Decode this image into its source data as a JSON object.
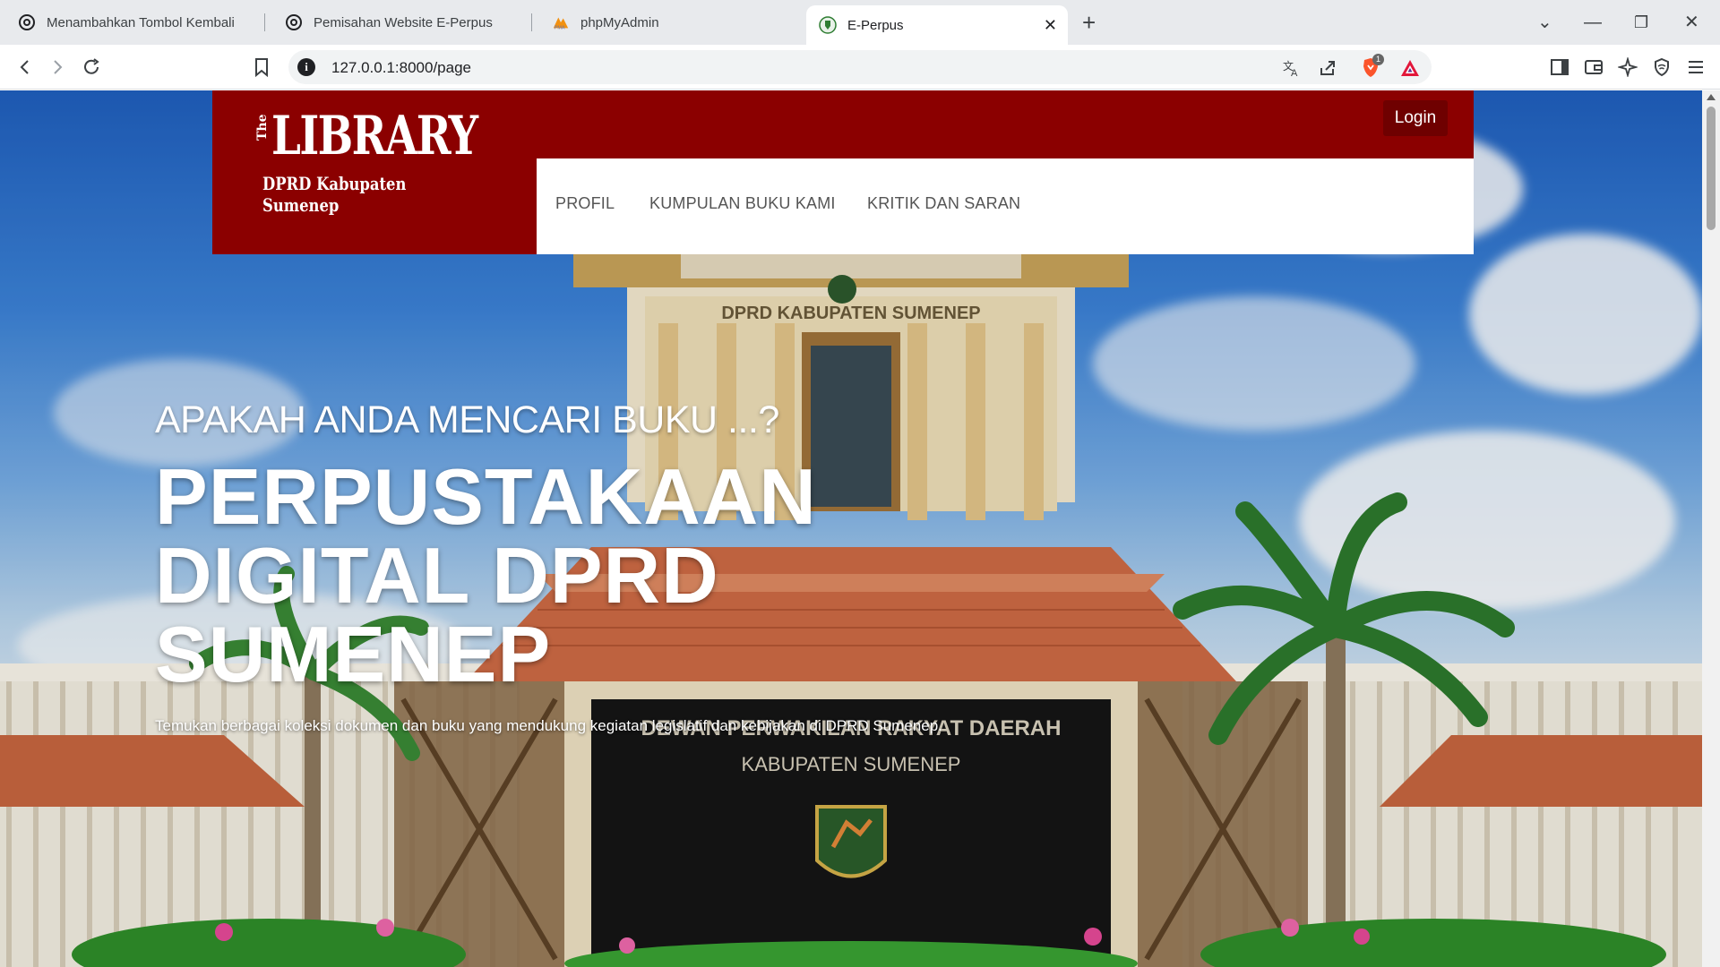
{
  "browser": {
    "tabs": [
      {
        "title": "Menambahkan Tombol Kembali",
        "icon": "chatgpt-icon"
      },
      {
        "title": "Pemisahan Website E-Perpus",
        "icon": "chatgpt-icon"
      },
      {
        "title": "phpMyAdmin",
        "icon": "phpmyadmin-icon"
      },
      {
        "title": "E-Perpus",
        "icon": "site-emblem-icon",
        "active": true
      }
    ],
    "url": "127.0.0.1:8000/page",
    "brave_badge_count": "1"
  },
  "header": {
    "logo_the": "The",
    "logo_main": "LIBRARY",
    "logo_sub": "DPRD Kabupaten Sumenep",
    "login_label": "Login",
    "nav": [
      "PROFIL",
      "KUMPULAN BUKU KAMI",
      "KRITIK DAN SARAN"
    ]
  },
  "hero": {
    "kicker": "APAKAH ANDA MENCARI BUKU ...?",
    "title_lines": [
      "PERPUSTAKAAN",
      "DIGITAL DPRD",
      "SUMENEP"
    ],
    "description": "Temukan berbagai koleksi dokumen dan buku yang mendukung kegiatan legislatif dan kebijakan di DPRD Sumenep.",
    "building_sign_top": "DPRD KABUPATEN SUMENEP",
    "building_sign_main": "DEWAN PERWAKILAN RAKYAT DAERAH",
    "building_sign_sub": "KABUPATEN SUMENEP"
  },
  "colors": {
    "brand_red": "#8b0000",
    "login_bg": "#6f0000",
    "nav_text": "#555555"
  }
}
